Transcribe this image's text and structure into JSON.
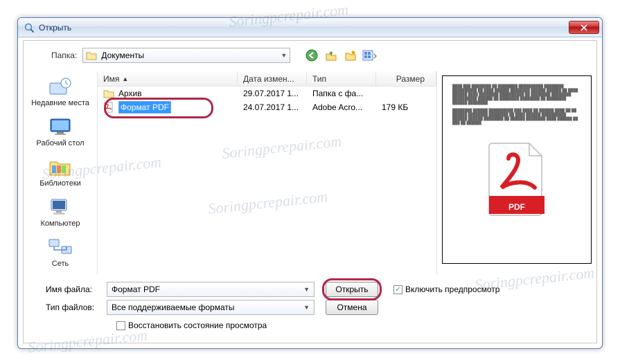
{
  "window": {
    "title": "Открыть"
  },
  "toolbar": {
    "folder_label": "Папка:",
    "folder_value": "Документы",
    "icons": {
      "back": "back-icon",
      "up": "up-icon",
      "newfolder": "newfolder-icon",
      "views": "views-icon"
    }
  },
  "places": [
    {
      "key": "recent",
      "label": "Недавние места"
    },
    {
      "key": "desktop",
      "label": "Рабочий стол"
    },
    {
      "key": "libraries",
      "label": "Библиотеки"
    },
    {
      "key": "computer",
      "label": "Компьютер"
    },
    {
      "key": "network",
      "label": "Сеть"
    }
  ],
  "columns": {
    "name": "Имя",
    "date": "Дата измен...",
    "type": "Тип",
    "size": "Размер"
  },
  "rows": [
    {
      "icon": "folder",
      "name": "Архив",
      "date": "29.07.2017 1...",
      "type": "Папка с фа...",
      "size": ""
    },
    {
      "icon": "pdf",
      "name": "Формат PDF",
      "date": "24.07.2017 1...",
      "type": "Adobe Acro...",
      "size": "179 КБ",
      "selected": true
    }
  ],
  "bottom": {
    "filename_label": "Имя файла:",
    "filename_value": "Формат PDF",
    "filetype_label": "Тип файлов:",
    "filetype_value": "Все поддерживаемые форматы",
    "restore_label": "Восстановить состояние просмотра",
    "open_label": "Открыть",
    "cancel_label": "Отмена",
    "preview_checkbox_label": "Включить предпросмотр",
    "preview_checked": true
  },
  "watermark": "Soringpcrepair.com"
}
